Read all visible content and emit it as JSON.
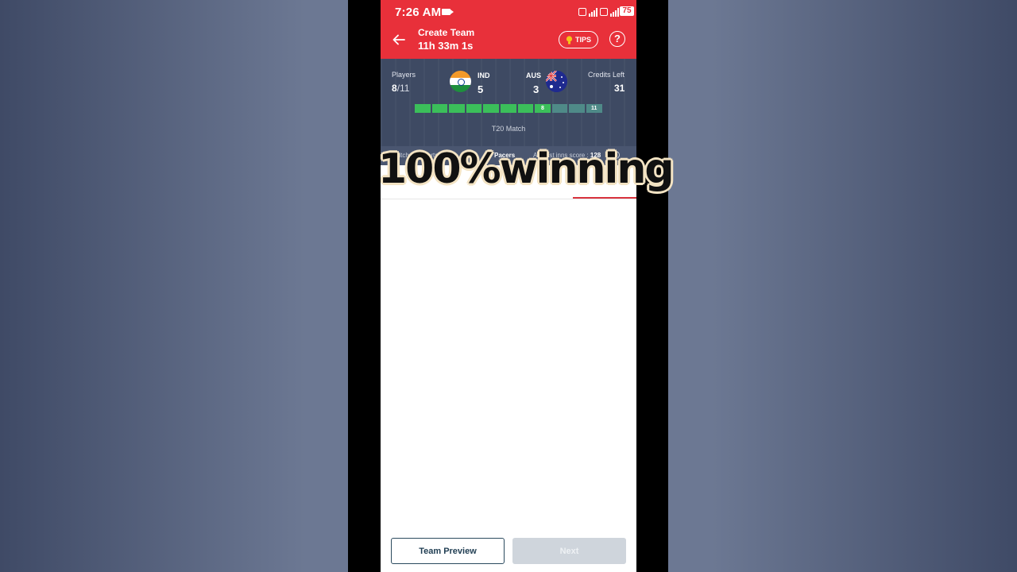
{
  "status": {
    "time": "7:26 AM",
    "battery": "75"
  },
  "header": {
    "title": "Create Team",
    "timer": "11h 33m 1s",
    "tips_label": "TIPS",
    "help_label": "?"
  },
  "match": {
    "players_label": "Players",
    "players_selected": "8",
    "players_total": "/11",
    "team1": {
      "name": "IND",
      "count": "5"
    },
    "team2": {
      "name": "AUS",
      "count": "3"
    },
    "credits_label": "Credits Left",
    "credits_value": "31",
    "progress_filled": 8,
    "progress_total": 11,
    "progress_marker_current": "8",
    "progress_marker_total": "11",
    "match_type": "T20 Match",
    "info_left": "Pitch: Supports :",
    "info_mid": "Pacers",
    "info_right_label": "Avg 1st inns score :",
    "info_right_value": "128"
  },
  "overlay_text": "100%winning",
  "footer": {
    "preview_label": "Team Preview",
    "next_label": "Next"
  },
  "colors": {
    "header": "#e8303a",
    "panel": "#3e4a63",
    "progress_filled": "#3bbf5a",
    "progress_empty": "#4f8a88"
  }
}
